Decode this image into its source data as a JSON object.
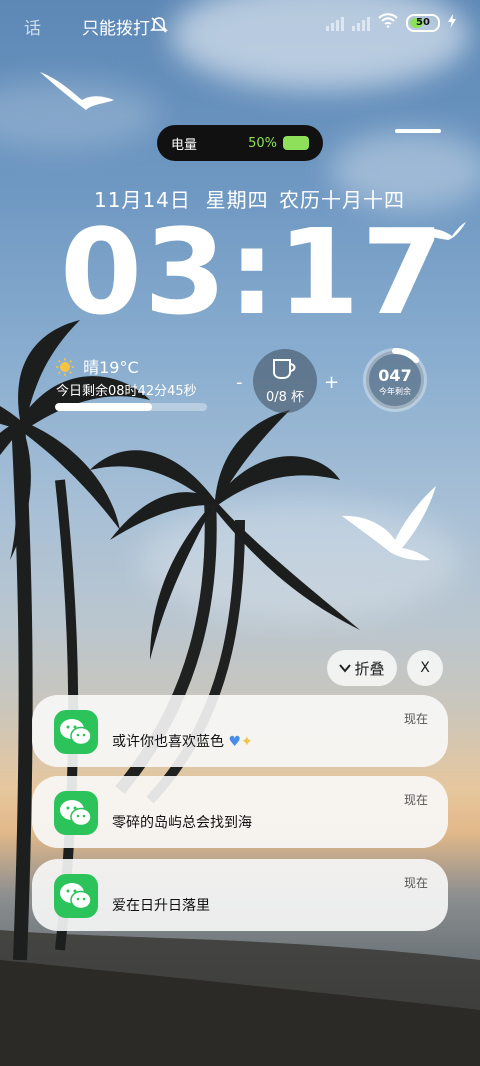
{
  "status_bar": {
    "left_text_1": "话",
    "left_text_2": "只能拨打",
    "battery_level": "50"
  },
  "battery_pill": {
    "label": "电量",
    "percent": "50%"
  },
  "lock_screen": {
    "date": "11月14日  星期四",
    "lunar": "农历十月十四",
    "time": "03:17"
  },
  "weather_widget": {
    "weather": "晴19°C",
    "countdown": "今日剩余08时42分45秒",
    "day_progress": 0.64
  },
  "water_widget": {
    "minus": "-",
    "plus": "+",
    "cups": "0/8 杯"
  },
  "ring_widget": {
    "number": "047",
    "sub": "今年剩余",
    "fraction": 0.13
  },
  "notifications": {
    "fold_label": "折叠",
    "close_label": "X",
    "items": [
      {
        "message": "或许你也喜欢蓝色",
        "time": "现在"
      },
      {
        "message": "零碎的岛屿总会找到海",
        "time": "现在"
      },
      {
        "message": "爱在日升日落里",
        "time": "现在"
      }
    ]
  },
  "colors": {
    "accent_green": "#8ee05a",
    "wechat_green": "#2bc35a"
  }
}
